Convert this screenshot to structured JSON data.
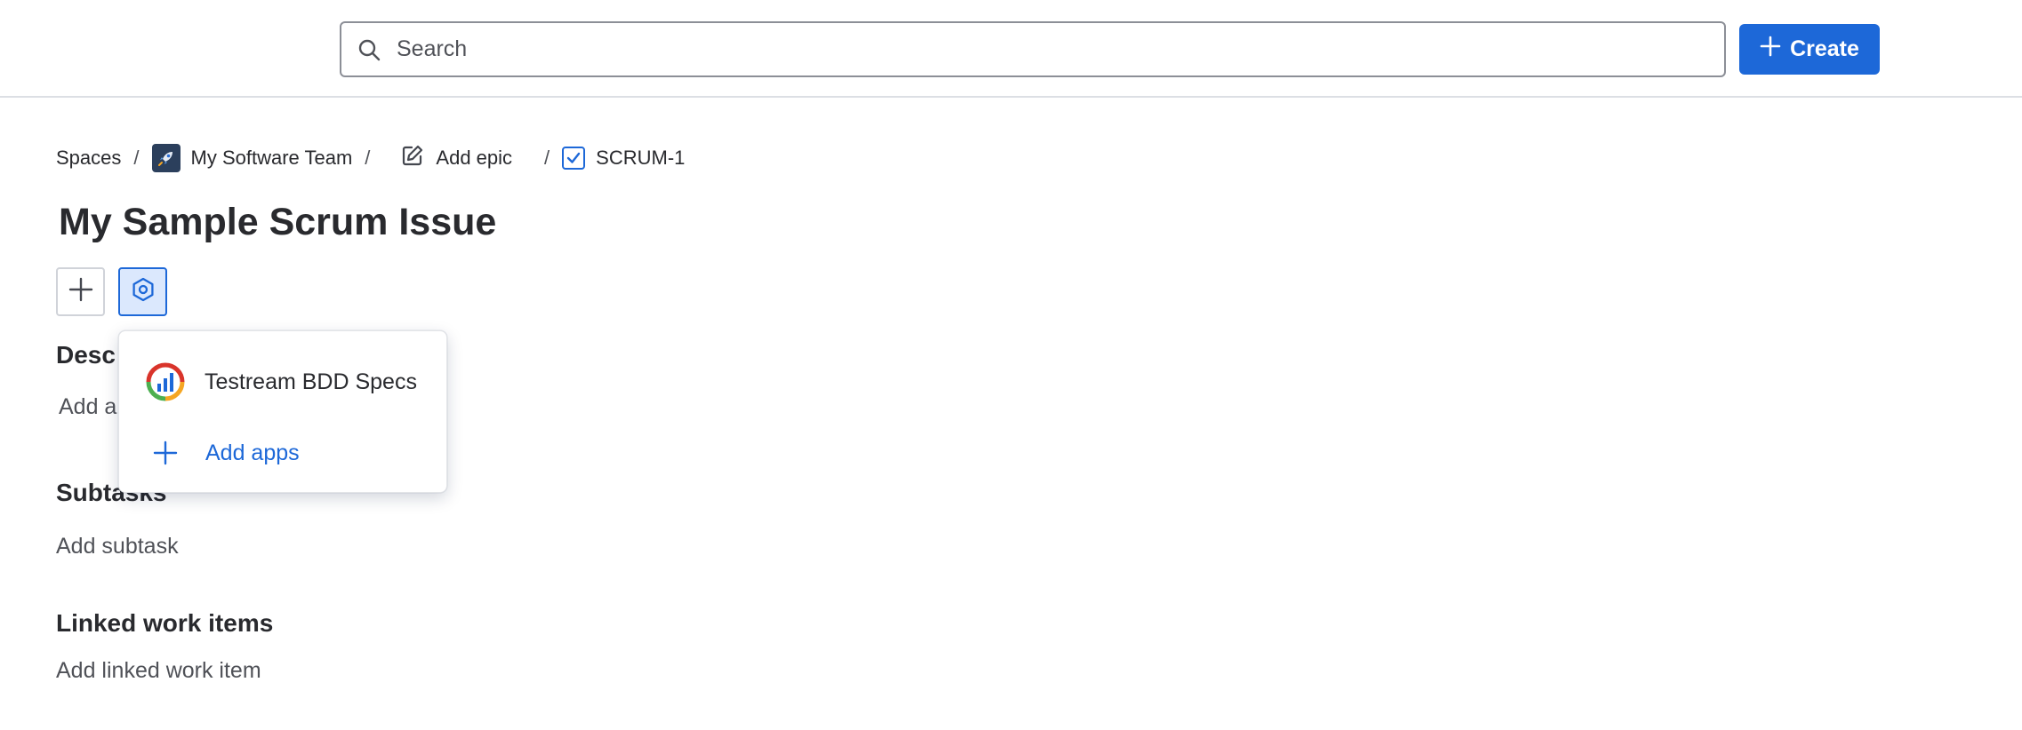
{
  "search": {
    "placeholder": "Search"
  },
  "header": {
    "create_label": "Create"
  },
  "colors": {
    "accent": "#1d68d8",
    "text": "#292a2e",
    "muted": "#505258"
  },
  "breadcrumb": {
    "spaces": "Spaces",
    "team": "My Software Team",
    "epic": "Add epic",
    "issue_key": "SCRUM-1"
  },
  "issue": {
    "title": "My Sample Scrum Issue"
  },
  "sections": {
    "description_heading": "Desc",
    "description_placeholder": "Add a",
    "subtasks_heading": "Subtasks",
    "subtasks_action": "Add subtask",
    "linked_heading": "Linked work items",
    "linked_action": "Add linked work item"
  },
  "apps_menu": {
    "items": [
      {
        "label": "Testream BDD Specs",
        "icon": "testream-logo-icon"
      },
      {
        "label": "Add apps",
        "icon": "plus-icon"
      }
    ]
  }
}
